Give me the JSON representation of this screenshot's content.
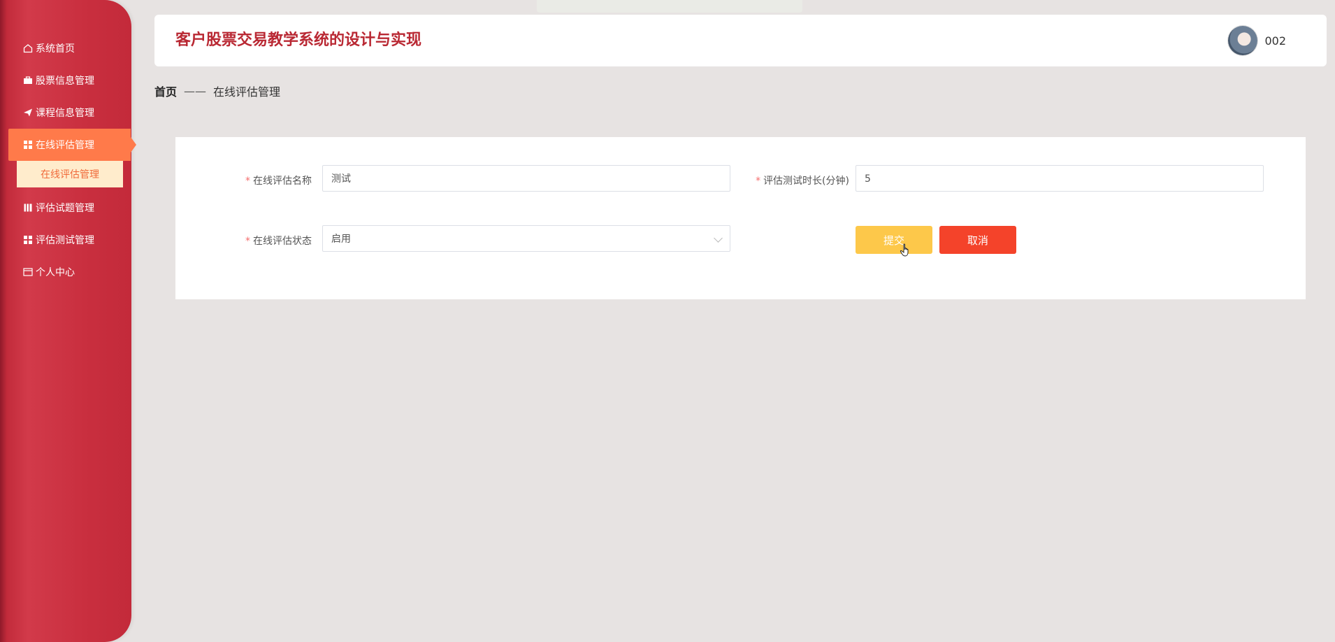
{
  "app": {
    "title": "客户股票交易教学系统的设计与实现"
  },
  "user": {
    "name": "002"
  },
  "sidebar": {
    "items": [
      {
        "label": "系统首页",
        "icon": "home-icon"
      },
      {
        "label": "股票信息管理",
        "icon": "briefcase-icon"
      },
      {
        "label": "课程信息管理",
        "icon": "send-icon"
      },
      {
        "label": "在线评估管理",
        "icon": "grid-icon",
        "active": true,
        "children": [
          {
            "label": "在线评估管理"
          }
        ]
      },
      {
        "label": "评估试题管理",
        "icon": "book-icon"
      },
      {
        "label": "评估测试管理",
        "icon": "grid-icon"
      },
      {
        "label": "个人中心",
        "icon": "wallet-icon"
      }
    ]
  },
  "breadcrumb": {
    "home": "首页",
    "separator": "——",
    "current": "在线评估管理"
  },
  "form": {
    "name_label": "在线评估名称",
    "name_value": "测试",
    "duration_label": "评估测试时长(分钟)",
    "duration_value": "5",
    "status_label": "在线评估状态",
    "status_value": "启用",
    "required_mark": "*",
    "submit_label": "提交",
    "cancel_label": "取消"
  },
  "colors": {
    "sidebar": "#c32a3a",
    "active_menu": "#ff7a4a",
    "submenu_bg": "#ffeccc",
    "title": "#b92833",
    "submit": "#fdc84a",
    "cancel": "#f4432a"
  }
}
